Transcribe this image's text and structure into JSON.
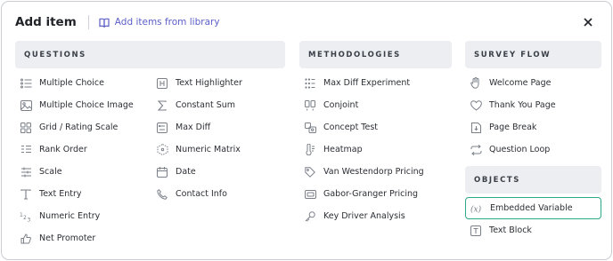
{
  "header": {
    "title": "Add item",
    "library_link": "Add items from library"
  },
  "sections": {
    "questions": {
      "title": "QUESTIONS",
      "col1": [
        "Multiple Choice",
        "Multiple Choice Image",
        "Grid / Rating Scale",
        "Rank Order",
        "Scale",
        "Text Entry",
        "Numeric Entry",
        "Net Promoter"
      ],
      "col2": [
        "Text Highlighter",
        "Constant Sum",
        "Max Diff",
        "Numeric Matrix",
        "Date",
        "Contact Info"
      ]
    },
    "methodologies": {
      "title": "METHODOLOGIES",
      "items": [
        "Max Diff Experiment",
        "Conjoint",
        "Concept Test",
        "Heatmap",
        "Van Westendorp Pricing",
        "Gabor-Granger Pricing",
        "Key Driver Analysis"
      ]
    },
    "survey_flow": {
      "title": "SURVEY FLOW",
      "items": [
        "Welcome Page",
        "Thank You Page",
        "Page Break",
        "Question Loop"
      ]
    },
    "objects": {
      "title": "OBJECTS",
      "items": [
        "Embedded Variable",
        "Text Block"
      ]
    }
  },
  "colors": {
    "accent_link": "#5b5fc7",
    "selected_border": "#2fa88a",
    "section_bg": "#eceef1",
    "icon": "#7a7f88"
  }
}
